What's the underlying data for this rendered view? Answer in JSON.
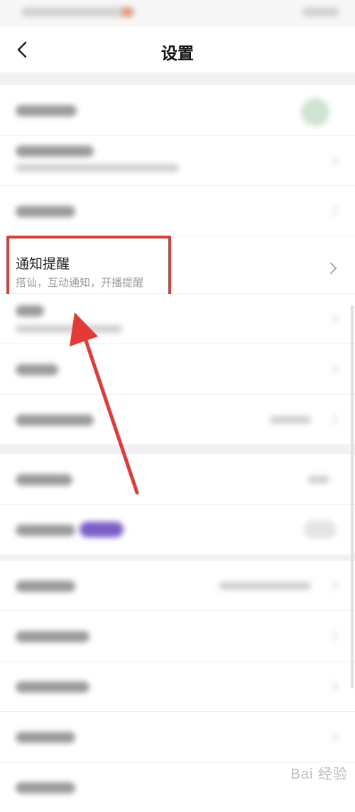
{
  "header": {
    "title": "设置",
    "back_icon": "chevron-left-icon"
  },
  "notification_item": {
    "title": "通知提醒",
    "subtitle": "搭讪，互动通知，开播提醒"
  },
  "annotation": {
    "highlight_color": "#e53935"
  },
  "watermark": {
    "text": "Bai 经验"
  }
}
